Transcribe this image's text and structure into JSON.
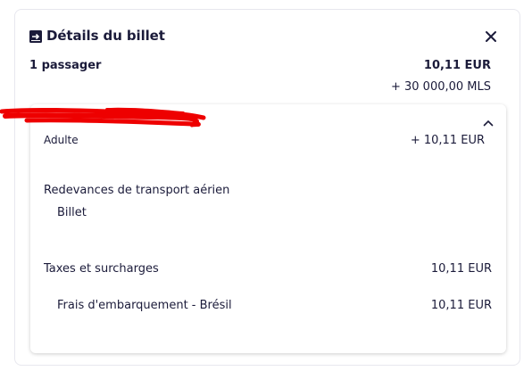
{
  "header": {
    "title": "Détails du billet",
    "close_icon": "close-icon",
    "ticket_icon": "ticket-icon"
  },
  "summary": {
    "passengers": "1 passager",
    "price": "10,11 EUR",
    "miles": "+ 30 000,00 MLS"
  },
  "breakdown": {
    "chevron_icon": "chevron-up-icon",
    "adult_label": "Adulte",
    "adult_value": "+ 10,11 EUR",
    "fees_label": "Redevances de transport aérien",
    "fees_sub_label": "Billet",
    "taxes_label": "Taxes et surcharges",
    "taxes_value": "10,11 EUR",
    "boarding_label": "Frais d'embarquement - Brésil",
    "boarding_value": "10,11 EUR"
  },
  "colors": {
    "text": "#1b1b3a",
    "redaction": "#ee0000"
  }
}
